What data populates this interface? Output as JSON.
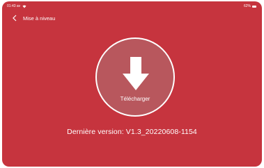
{
  "status_bar": {
    "time": "01:43 av",
    "battery": "62%"
  },
  "header": {
    "title": "Mise à niveau"
  },
  "main": {
    "download_label": "Télécharger",
    "version_text": "Dernière version: V1.3_20220608-1154"
  },
  "icons": {
    "back": "chevron-left-icon",
    "download": "arrow-down-icon",
    "wifi": "wifi-icon",
    "battery": "battery-icon"
  },
  "colors": {
    "background": "#c6343e",
    "button_fill": "#b8575d",
    "foreground": "#ffffff"
  }
}
